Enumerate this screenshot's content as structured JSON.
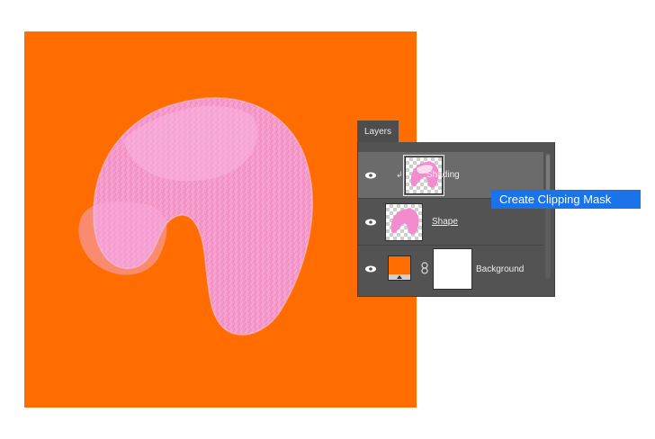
{
  "canvas": {
    "background_color": "#ff6d00",
    "shape_color": "#f28ccf"
  },
  "layers_panel": {
    "tab_label": "Layers",
    "layers": [
      {
        "name": "Shading",
        "thumbnail": "pink-shape-with-shading",
        "clipped": true,
        "visible": true
      },
      {
        "name": "Shape",
        "thumbnail": "pink-shape",
        "visible": true
      },
      {
        "name": "Background",
        "thumbnail": "solid-color-fill",
        "visible": true
      }
    ]
  },
  "tooltip": {
    "label": "Create Clipping Mask",
    "color": "#1a73e8"
  }
}
